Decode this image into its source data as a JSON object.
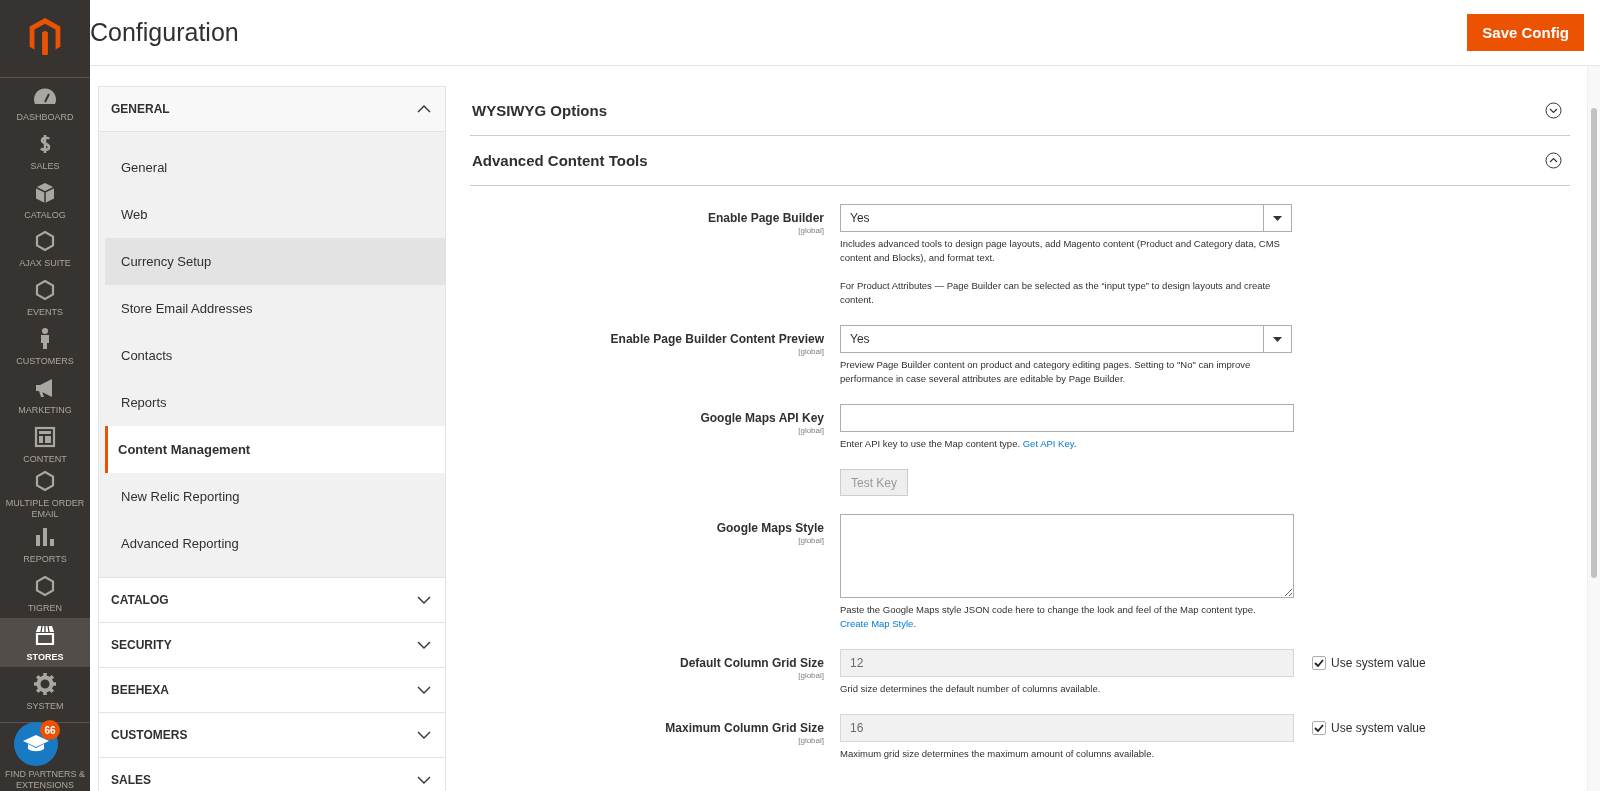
{
  "menu": [
    {
      "label": "DASHBOARD",
      "selected": false
    },
    {
      "label": "SALES",
      "selected": false
    },
    {
      "label": "CATALOG",
      "selected": false
    },
    {
      "label": "AJAX SUITE",
      "selected": false
    },
    {
      "label": "EVENTS",
      "selected": false
    },
    {
      "label": "CUSTOMERS",
      "selected": false
    },
    {
      "label": "MARKETING",
      "selected": false
    },
    {
      "label": "CONTENT",
      "selected": false
    },
    {
      "label": "MULTIPLE ORDER EMAIL",
      "selected": false
    },
    {
      "label": "REPORTS",
      "selected": false
    },
    {
      "label": "TIGREN",
      "selected": false
    },
    {
      "label": "STORES",
      "selected": true
    },
    {
      "label": "SYSTEM",
      "selected": false
    },
    {
      "label": "FIND PARTNERS & EXTENSIONS",
      "selected": false
    }
  ],
  "help_badge": {
    "count": "66"
  },
  "header": {
    "title": "Configuration",
    "save_button": "Save Config"
  },
  "config_nav": [
    {
      "title": "GENERAL",
      "expanded": true,
      "items": [
        {
          "label": "General",
          "selected": false,
          "highlighted": false
        },
        {
          "label": "Web",
          "selected": false,
          "highlighted": false
        },
        {
          "label": "Currency Setup",
          "selected": false,
          "highlighted": true
        },
        {
          "label": "Store Email Addresses",
          "selected": false,
          "highlighted": false
        },
        {
          "label": "Contacts",
          "selected": false,
          "highlighted": false
        },
        {
          "label": "Reports",
          "selected": false,
          "highlighted": false
        },
        {
          "label": "Content Management",
          "selected": true,
          "highlighted": false
        },
        {
          "label": "New Relic Reporting",
          "selected": false,
          "highlighted": false
        },
        {
          "label": "Advanced Reporting",
          "selected": false,
          "highlighted": false
        }
      ]
    },
    {
      "title": "CATALOG",
      "expanded": false
    },
    {
      "title": "SECURITY",
      "expanded": false
    },
    {
      "title": "BEEHEXA",
      "expanded": false
    },
    {
      "title": "CUSTOMERS",
      "expanded": false
    },
    {
      "title": "SALES",
      "expanded": false
    }
  ],
  "sections": [
    {
      "title": "WYSIWYG Options",
      "expanded": false
    },
    {
      "title": "Advanced Content Tools",
      "expanded": true,
      "fields": [
        {
          "kind": "select",
          "label": "Enable Page Builder",
          "scope": "[global]",
          "value": "Yes",
          "notes": [
            {
              "text": "Includes advanced tools to design page layouts, add Magento content (Product and Category data, CMS content and Blocks), and format text."
            },
            {
              "text": "For Product Attributes — Page Builder can be selected as the “input type” to design layouts and create content."
            }
          ]
        },
        {
          "kind": "select",
          "label": "Enable Page Builder Content Preview",
          "scope": "[global]",
          "value": "Yes",
          "notes": [
            {
              "text": "Preview Page Builder content on product and category editing pages. Setting to \"No\" can improve performance in case several attributes are editable by Page Builder."
            }
          ]
        },
        {
          "kind": "input",
          "label": "Google Maps API Key",
          "scope": "[global]",
          "disabled": false,
          "notes": [
            {
              "text": "Enter API key to use the Map content type. ",
              "link": "Get API Key",
              "after": "."
            }
          ]
        },
        {
          "kind": "button",
          "label": "Test Key",
          "disabled": true
        },
        {
          "kind": "textarea",
          "label": "Google Maps Style",
          "scope": "[global]",
          "notes": [
            {
              "text": "Paste the Google Maps style JSON code here to change the look and feel of the Map content type. ",
              "link": "Create Map Style",
              "after": "."
            }
          ]
        },
        {
          "kind": "input",
          "label": "Default Column Grid Size",
          "scope": "[global]",
          "value": "12",
          "disabled": true,
          "system": {
            "label": "Use system value",
            "checked": true
          },
          "notes": [
            {
              "text": "Grid size determines the default number of columns available."
            }
          ]
        },
        {
          "kind": "input",
          "label": "Maximum Column Grid Size",
          "scope": "[global]",
          "value": "16",
          "disabled": true,
          "system": {
            "label": "Use system value",
            "checked": true
          },
          "notes": [
            {
              "text": "Maximum grid size determines the maximum amount of columns available."
            }
          ]
        }
      ]
    }
  ]
}
